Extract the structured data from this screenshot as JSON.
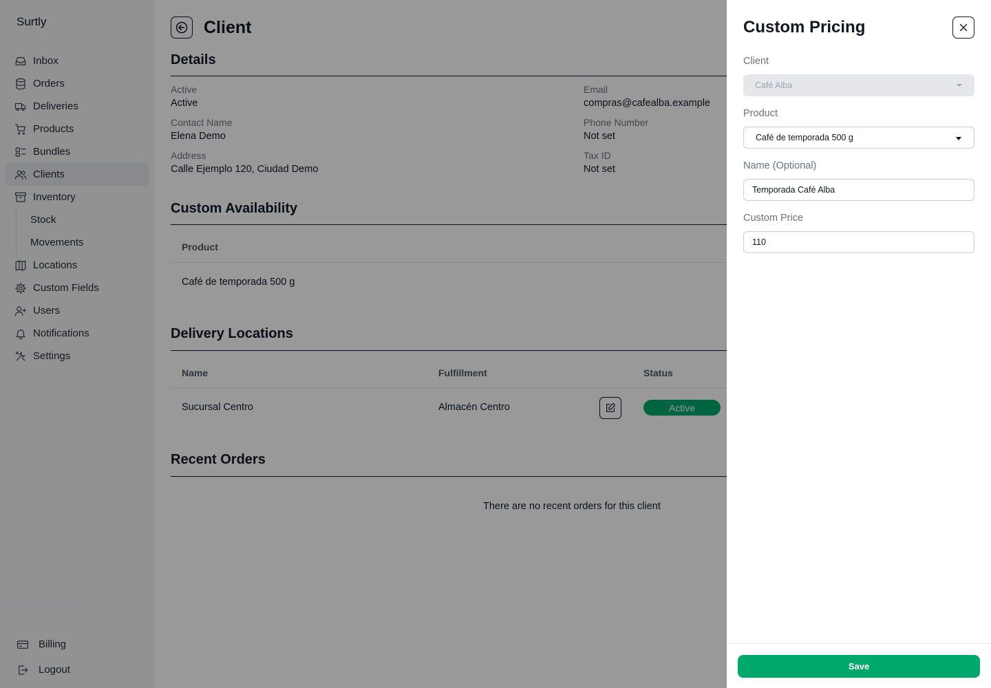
{
  "app": {
    "brand": "Surtly"
  },
  "sidebar": {
    "items": [
      {
        "label": "Inbox",
        "icon": "inbox-icon"
      },
      {
        "label": "Orders",
        "icon": "database-icon"
      },
      {
        "label": "Deliveries",
        "icon": "truck-icon"
      },
      {
        "label": "Products",
        "icon": "cart-icon"
      },
      {
        "label": "Bundles",
        "icon": "bundles-icon"
      },
      {
        "label": "Clients",
        "icon": "users-icon",
        "active": true
      },
      {
        "label": "Inventory",
        "icon": "archive-icon"
      },
      {
        "label": "Stock"
      },
      {
        "label": "Movements"
      },
      {
        "label": "Locations",
        "icon": "map-icon"
      },
      {
        "label": "Custom Fields",
        "icon": "cog-icon"
      },
      {
        "label": "Users",
        "icon": "user-plus-icon"
      },
      {
        "label": "Notifications",
        "icon": "bell-icon"
      },
      {
        "label": "Settings",
        "icon": "tools-icon"
      }
    ],
    "bottom": [
      {
        "label": "Billing",
        "icon": "credit-card-icon"
      },
      {
        "label": "Logout",
        "icon": "logout-icon"
      }
    ]
  },
  "page": {
    "title": "Client",
    "details": {
      "heading": "Details",
      "active_label": "Active",
      "active_value": "Active",
      "email_label": "Email",
      "email_value": "compras@cafealba.example",
      "contact_label": "Contact Name",
      "contact_value": "Elena Demo",
      "phone_label": "Phone Number",
      "phone_value": "Not set",
      "address_label": "Address",
      "address_value": "Calle Ejemplo 120, Ciudad Demo",
      "tax_label": "Tax ID",
      "tax_value": "Not set"
    },
    "availability": {
      "heading": "Custom Availability",
      "col_product": "Product",
      "rows": [
        {
          "product": "Café de temporada 500 g"
        }
      ]
    },
    "delivery": {
      "heading": "Delivery Locations",
      "col_name": "Name",
      "col_fulfillment": "Fulfillment",
      "col_status": "Status",
      "rows": [
        {
          "name": "Sucursal Centro",
          "fulfillment": "Almacén Centro",
          "status": "Active"
        }
      ]
    },
    "orders": {
      "heading": "Recent Orders",
      "empty": "There are no recent orders for this client"
    }
  },
  "drawer": {
    "title": "Custom Pricing",
    "client_label": "Client",
    "client_value": "Café Alba",
    "product_label": "Product",
    "product_value": "Café de temporada 500 g",
    "name_label": "Name (Optional)",
    "name_value": "Temporada Café Alba",
    "price_label": "Custom Price",
    "price_value": "110",
    "save_label": "Save"
  },
  "colors": {
    "accent": "#00a86b",
    "overlay": "rgba(0,0,0,0.40)"
  }
}
